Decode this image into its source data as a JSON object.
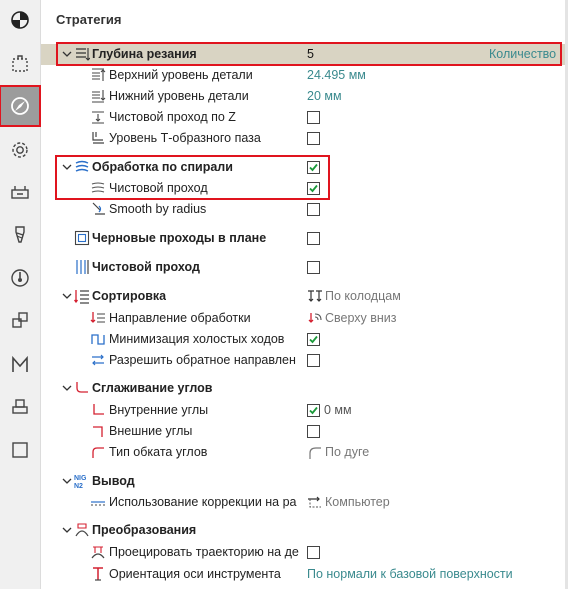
{
  "panel": {
    "title": "Стратегия"
  },
  "toolbar": {
    "items": [
      {
        "icon": "target-icon"
      },
      {
        "icon": "selection-icon"
      },
      {
        "icon": "strategy-compass-icon"
      },
      {
        "icon": "gear-icon"
      },
      {
        "icon": "machine-icon"
      },
      {
        "icon": "tool-icon"
      },
      {
        "icon": "speed-icon"
      },
      {
        "icon": "blocks-icon"
      },
      {
        "icon": "macro-m-icon"
      },
      {
        "icon": "stand-icon"
      },
      {
        "icon": "blank-square-icon"
      }
    ]
  },
  "rows": {
    "depth": {
      "label": "Глубина резания",
      "value": "5",
      "extra": "Количество"
    },
    "top_level": {
      "label": "Верхний уровень детали",
      "value": "24.495 мм"
    },
    "bottom_level": {
      "label": "Нижний уровень детали",
      "value": "20 мм"
    },
    "finish_z": {
      "label": "Чистовой проход по Z",
      "checked": false
    },
    "t_slot": {
      "label": "Уровень Т-образного паза",
      "checked": false
    },
    "spiral": {
      "label": "Обработка по спирали",
      "checked": true
    },
    "spiral_finish": {
      "label": "Чистовой проход",
      "checked": true
    },
    "smooth_radius": {
      "label": "Smooth by radius",
      "checked": false
    },
    "rough_plan": {
      "label": "Черновые проходы в плане",
      "checked": false
    },
    "finish_pass": {
      "label": "Чистовой проход",
      "checked": false
    },
    "sorting": {
      "label": "Сортировка",
      "value": "По колодцам"
    },
    "direction": {
      "label": "Направление обработки",
      "value": "Сверху вниз"
    },
    "min_idle": {
      "label": "Минимизация холостых ходов",
      "checked": true
    },
    "allow_reverse": {
      "label": "Разрешить обратное направлен",
      "checked": false
    },
    "corner_smooth": {
      "label": "Сглаживание углов"
    },
    "inner_corners": {
      "label": "Внутренние углы",
      "checked": true,
      "value": "0 мм"
    },
    "outer_corners": {
      "label": "Внешние углы",
      "checked": false
    },
    "round_type": {
      "label": "Тип обката углов",
      "value": "По дуге"
    },
    "output": {
      "label": "Вывод"
    },
    "correction": {
      "label": "Использование коррекции на ра",
      "value": "Компьютер"
    },
    "transform": {
      "label": "Преобразования"
    },
    "project_path": {
      "label": "Проецировать траекторию на де",
      "checked": false
    },
    "tool_axis": {
      "label": "Ориентация оси инструмента",
      "value": "По нормали к базовой поверхности"
    }
  },
  "colors": {
    "accent_value": "#3a8a8e",
    "highlight": "#d9d4c3",
    "annotation": "#e0141e",
    "active_tool": "#9c9c9c"
  }
}
